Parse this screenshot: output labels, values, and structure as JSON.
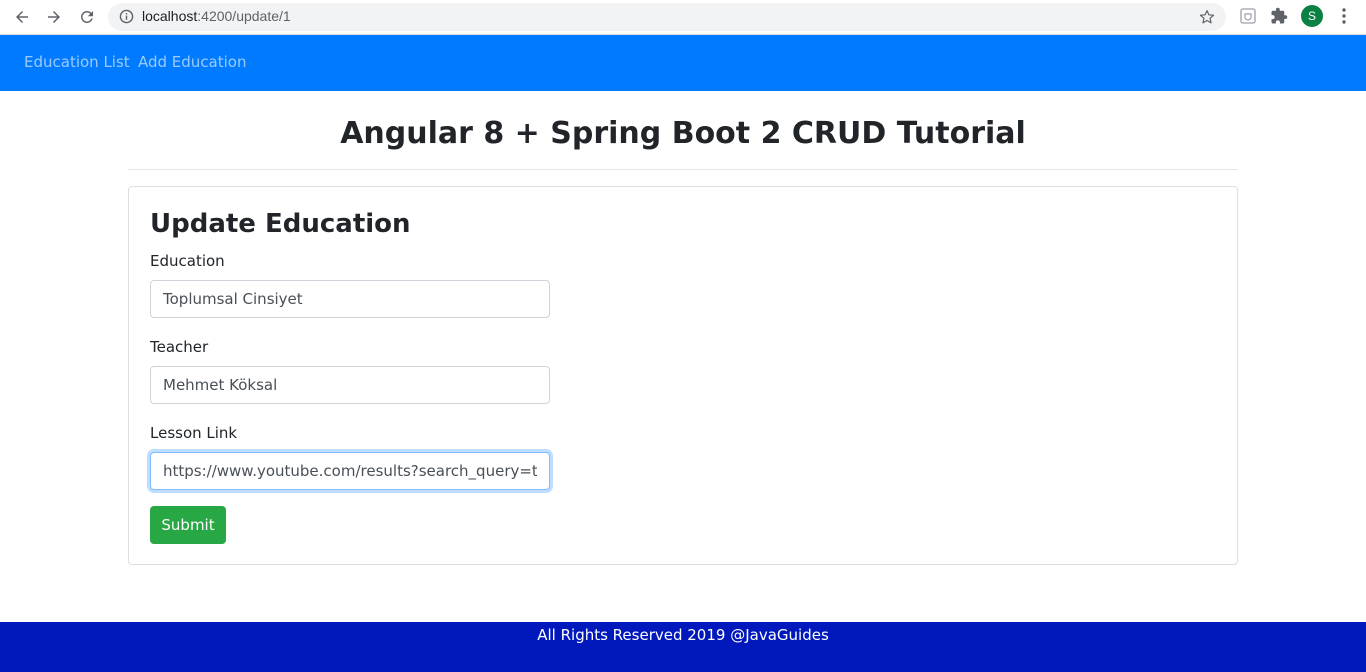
{
  "browser": {
    "url_host": "localhost",
    "url_path": ":4200/update/1",
    "profile_initial": "S"
  },
  "navbar": {
    "links": [
      "Education List",
      "Add Education"
    ],
    "color": "#007bff"
  },
  "page": {
    "title": "Angular 8 + Spring Boot 2 CRUD Tutorial"
  },
  "form": {
    "heading": "Update Education",
    "fields": [
      {
        "label": "Education",
        "value": "Toplumsal Cinsiyet"
      },
      {
        "label": "Teacher",
        "value": "Mehmet Köksal"
      },
      {
        "label": "Lesson Link",
        "value": "https://www.youtube.com/results?search_query=topl"
      }
    ],
    "submit_label": "Submit",
    "submit_color": "#28a745"
  },
  "footer": {
    "text": "All Rights Reserved 2019 @JavaGuides",
    "color": "#0018bc"
  },
  "icons": [
    "back-arrow-icon",
    "forward-arrow-icon",
    "reload-icon",
    "info-icon",
    "star-icon",
    "extension-icon",
    "puzzle-icon",
    "kebab-menu-icon"
  ]
}
